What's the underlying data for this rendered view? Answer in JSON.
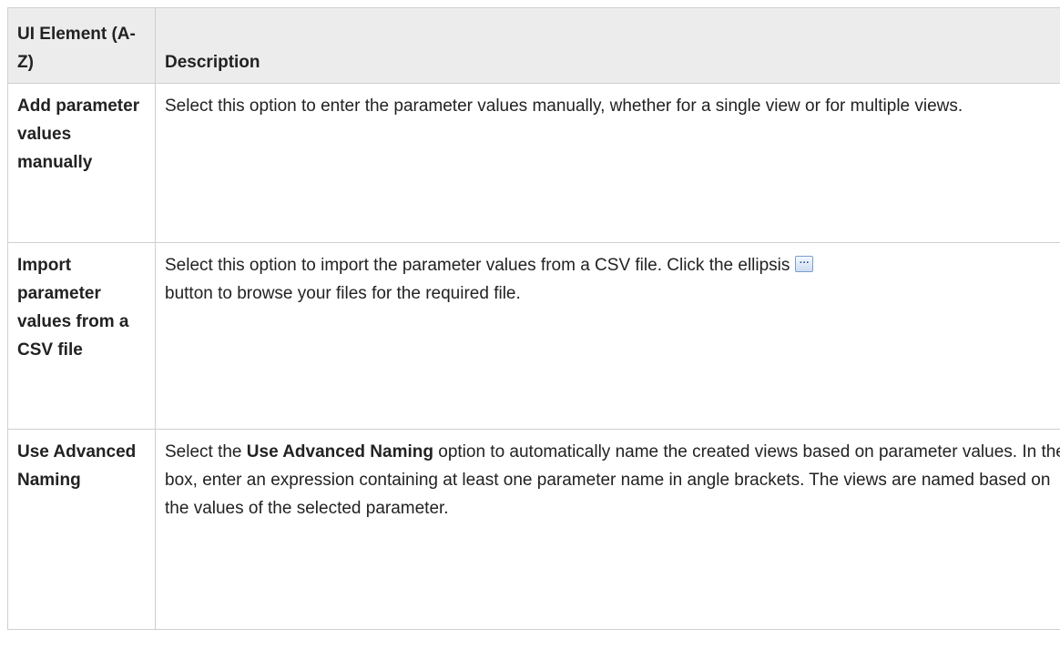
{
  "table": {
    "headers": {
      "element": "UI Element (A-Z)",
      "description": "Description"
    },
    "rows": [
      {
        "element": "Add parameter values manually",
        "description": "Select this option to enter the parameter values manually, whether for a single view or for multiple views."
      },
      {
        "element": "Import parameter values from a CSV file",
        "description_before": "Select this option to import the parameter values from a CSV file. Click the ellipsis",
        "button_icon": "ellipsis-button-icon",
        "description_after": "button to browse your files for the required file."
      },
      {
        "element": "Use Advanced Naming",
        "description_prefix": "Select the",
        "description_bold": "Use Advanced Naming",
        "description_suffix": "option to automatically name the created views based on parameter values. In the box, enter an expression containing at least one parameter name in angle brackets. The views are named based on the values of the selected parameter."
      }
    ]
  }
}
